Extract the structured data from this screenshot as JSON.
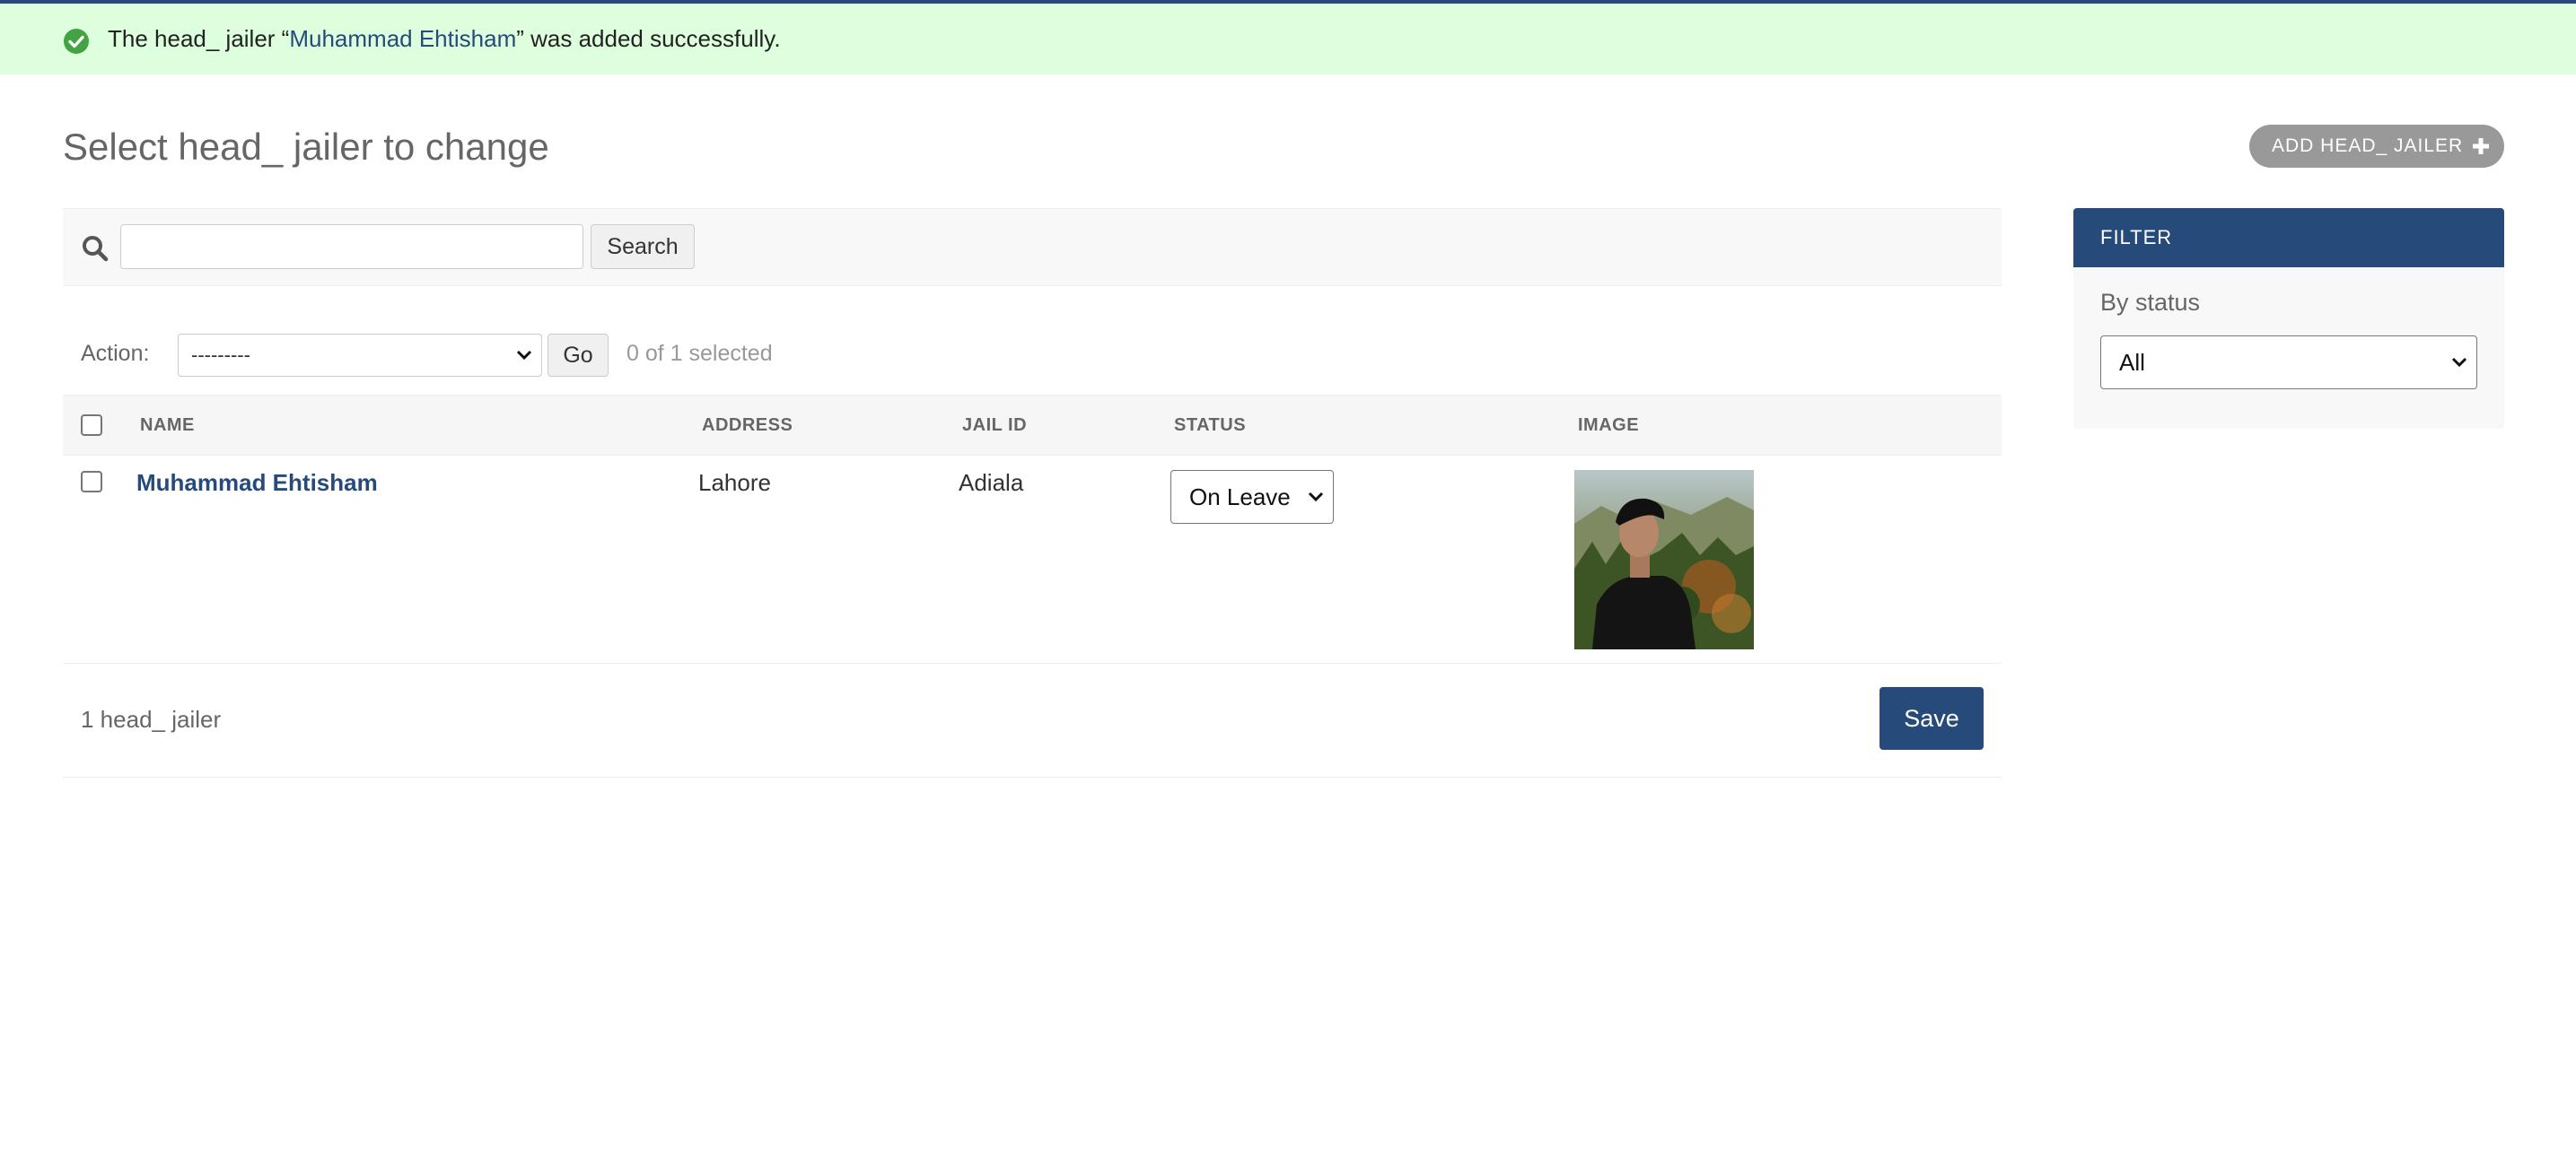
{
  "message": {
    "prefix": "The head_ jailer “",
    "link": "Muhammad Ehtisham",
    "suffix": "” was added successfully.",
    "icon": "check-circle-icon"
  },
  "page_title": "Select head_ jailer to change",
  "add_button": {
    "label": "ADD HEAD_ JAILER",
    "icon": "plus-icon"
  },
  "search": {
    "value": "",
    "button_label": "Search",
    "icon": "search-icon"
  },
  "actions": {
    "label": "Action:",
    "selected": "---------",
    "go_label": "Go",
    "counter": "0 of 1 selected"
  },
  "table": {
    "columns": [
      "NAME",
      "ADDRESS",
      "JAIL ID",
      "STATUS",
      "IMAGE"
    ],
    "rows": [
      {
        "name": "Muhammad Ehtisham",
        "address": "Lahore",
        "jail_id": "Adiala",
        "status": "On Leave"
      }
    ]
  },
  "paginator": {
    "count": "1 head_ jailer",
    "save_label": "Save"
  },
  "filter": {
    "header": "FILTER",
    "subtitle": "By status",
    "selected": "All"
  },
  "colors": {
    "primary": "#264b7a",
    "success_bg": "#ddffdd",
    "success_icon": "#41a341",
    "add_button": "#999999"
  }
}
